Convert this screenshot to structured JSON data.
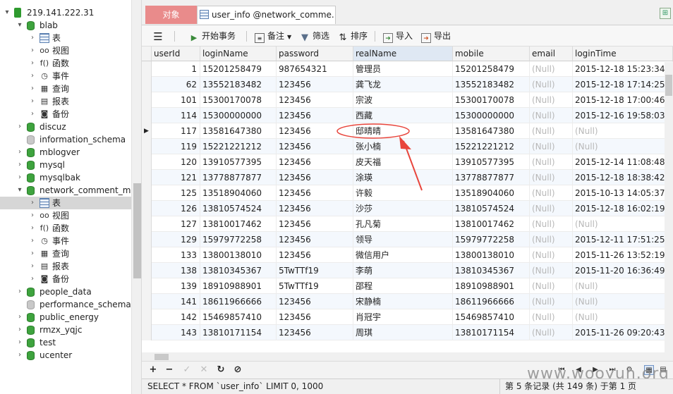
{
  "sidebar": {
    "items": [
      {
        "label": "219.141.222.31",
        "icon": "server-icon",
        "arrow": "▾"
      },
      {
        "label": "blab",
        "icon": "database-icon",
        "arrow": "▾"
      },
      {
        "label": "表",
        "icon": "table-icon",
        "arrow": "›"
      },
      {
        "label": "视图",
        "icon": "view-icon",
        "arrow": "›"
      },
      {
        "label": "函数",
        "icon": "function-icon",
        "arrow": "›"
      },
      {
        "label": "事件",
        "icon": "event-icon",
        "arrow": "›"
      },
      {
        "label": "查询",
        "icon": "query-icon",
        "arrow": "›"
      },
      {
        "label": "报表",
        "icon": "report-icon",
        "arrow": "›"
      },
      {
        "label": "备份",
        "icon": "backup-icon",
        "arrow": "›"
      },
      {
        "label": "discuz",
        "icon": "database-icon",
        "arrow": "›"
      },
      {
        "label": "information_schema",
        "icon": "database-grey-icon",
        "arrow": ""
      },
      {
        "label": "mblogver",
        "icon": "database-icon",
        "arrow": "›"
      },
      {
        "label": "mysql",
        "icon": "database-icon",
        "arrow": "›"
      },
      {
        "label": "mysqlbak",
        "icon": "database-icon",
        "arrow": "›"
      },
      {
        "label": "network_comment_ma",
        "icon": "database-icon",
        "arrow": "▾"
      },
      {
        "label": "表",
        "icon": "table-icon",
        "arrow": "›"
      },
      {
        "label": "视图",
        "icon": "view-icon",
        "arrow": "›"
      },
      {
        "label": "函数",
        "icon": "function-icon",
        "arrow": "›"
      },
      {
        "label": "事件",
        "icon": "event-icon",
        "arrow": "›"
      },
      {
        "label": "查询",
        "icon": "query-icon",
        "arrow": "›"
      },
      {
        "label": "报表",
        "icon": "report-icon",
        "arrow": "›"
      },
      {
        "label": "备份",
        "icon": "backup-icon",
        "arrow": "›"
      },
      {
        "label": "people_data",
        "icon": "database-icon",
        "arrow": "›"
      },
      {
        "label": "performance_schema",
        "icon": "database-grey-icon",
        "arrow": ""
      },
      {
        "label": "public_energy",
        "icon": "database-icon",
        "arrow": "›"
      },
      {
        "label": "rmzx_yqjc",
        "icon": "database-icon",
        "arrow": "›"
      },
      {
        "label": "test",
        "icon": "database-icon",
        "arrow": "›"
      },
      {
        "label": "ucenter",
        "icon": "database-icon",
        "arrow": "›"
      }
    ]
  },
  "tabs": {
    "objects": "对象",
    "query": "user_info @network_comme..."
  },
  "toolbar": {
    "menu_icon": "menu-icon",
    "begin_transaction": "开始事务",
    "note": "备注",
    "filter": "筛选",
    "sort": "排序",
    "import": "导入",
    "export": "导出"
  },
  "grid": {
    "columns": [
      "userId",
      "loginName",
      "password",
      "realName",
      "mobile",
      "email",
      "loginTime"
    ],
    "selected_column": "realName",
    "rows": [
      [
        "1",
        "15201258479",
        "987654321",
        "管理员",
        "15201258479",
        "(Null)",
        "2015-12-18 15:23:34"
      ],
      [
        "62",
        "13552183482",
        "123456",
        "龚飞龙",
        "13552183482",
        "(Null)",
        "2015-12-18 17:14:25"
      ],
      [
        "101",
        "15300170078",
        "123456",
        "宗波",
        "15300170078",
        "(Null)",
        "2015-12-18 17:00:46"
      ],
      [
        "114",
        "15300000000",
        "123456",
        "西藏",
        "15300000000",
        "(Null)",
        "2015-12-16 19:58:03"
      ],
      [
        "117",
        "13581647380",
        "123456",
        "邸晴晴",
        "13581647380",
        "(Null)",
        "(Null)"
      ],
      [
        "119",
        "15221221212",
        "123456",
        "张小楠",
        "15221221212",
        "(Null)",
        "(Null)"
      ],
      [
        "120",
        "13910577395",
        "123456",
        "皮天福",
        "13910577395",
        "(Null)",
        "2015-12-14 11:08:48"
      ],
      [
        "121",
        "13778877877",
        "123456",
        "涂瑛",
        "13778877877",
        "(Null)",
        "2015-12-18 18:38:42"
      ],
      [
        "125",
        "13518904060",
        "123456",
        "许毅",
        "13518904060",
        "(Null)",
        "2015-10-13 14:05:37"
      ],
      [
        "126",
        "13810574524",
        "123456",
        "沙莎",
        "13810574524",
        "(Null)",
        "2015-12-18 16:02:19"
      ],
      [
        "127",
        "13810017462",
        "123456",
        "孔凡菊",
        "13810017462",
        "(Null)",
        "(Null)"
      ],
      [
        "129",
        "15979772258",
        "123456",
        "领导",
        "15979772258",
        "(Null)",
        "2015-12-11 17:51:25"
      ],
      [
        "133",
        "13800138010",
        "123456",
        "微信用户",
        "13800138010",
        "(Null)",
        "2015-11-26 13:52:19"
      ],
      [
        "138",
        "13810345367",
        "5TwTTf19",
        "李萌",
        "13810345367",
        "(Null)",
        "2015-11-20 16:36:49"
      ],
      [
        "139",
        "18910988901",
        "5TwTTf19",
        "邵程",
        "18910988901",
        "(Null)",
        "(Null)"
      ],
      [
        "141",
        "18611966666",
        "123456",
        "宋静楠",
        "18611966666",
        "(Null)",
        "(Null)"
      ],
      [
        "142",
        "15469857410",
        "123456",
        "肖冠宇",
        "15469857410",
        "(Null)",
        "(Null)"
      ],
      [
        "143",
        "13810171154",
        "123456",
        "周琪",
        "13810171154",
        "(Null)",
        "2015-11-26 09:20:43"
      ]
    ],
    "current_row_index": 4
  },
  "navbar": {
    "add": "+",
    "delete": "−",
    "apply": "✓",
    "discard": "✕",
    "refresh": "↻",
    "stop": "⊘"
  },
  "watermark": "www.wooyun.org",
  "status": {
    "sql": "SELECT * FROM `user_info` LIMIT 0, 1000",
    "records": "第 5 条记录 (共 149 条) 于第 1 页"
  },
  "colors": {
    "tab_active": "#e98b8b",
    "annotation": "#e8453c",
    "null_text": "#b8b8b8"
  }
}
